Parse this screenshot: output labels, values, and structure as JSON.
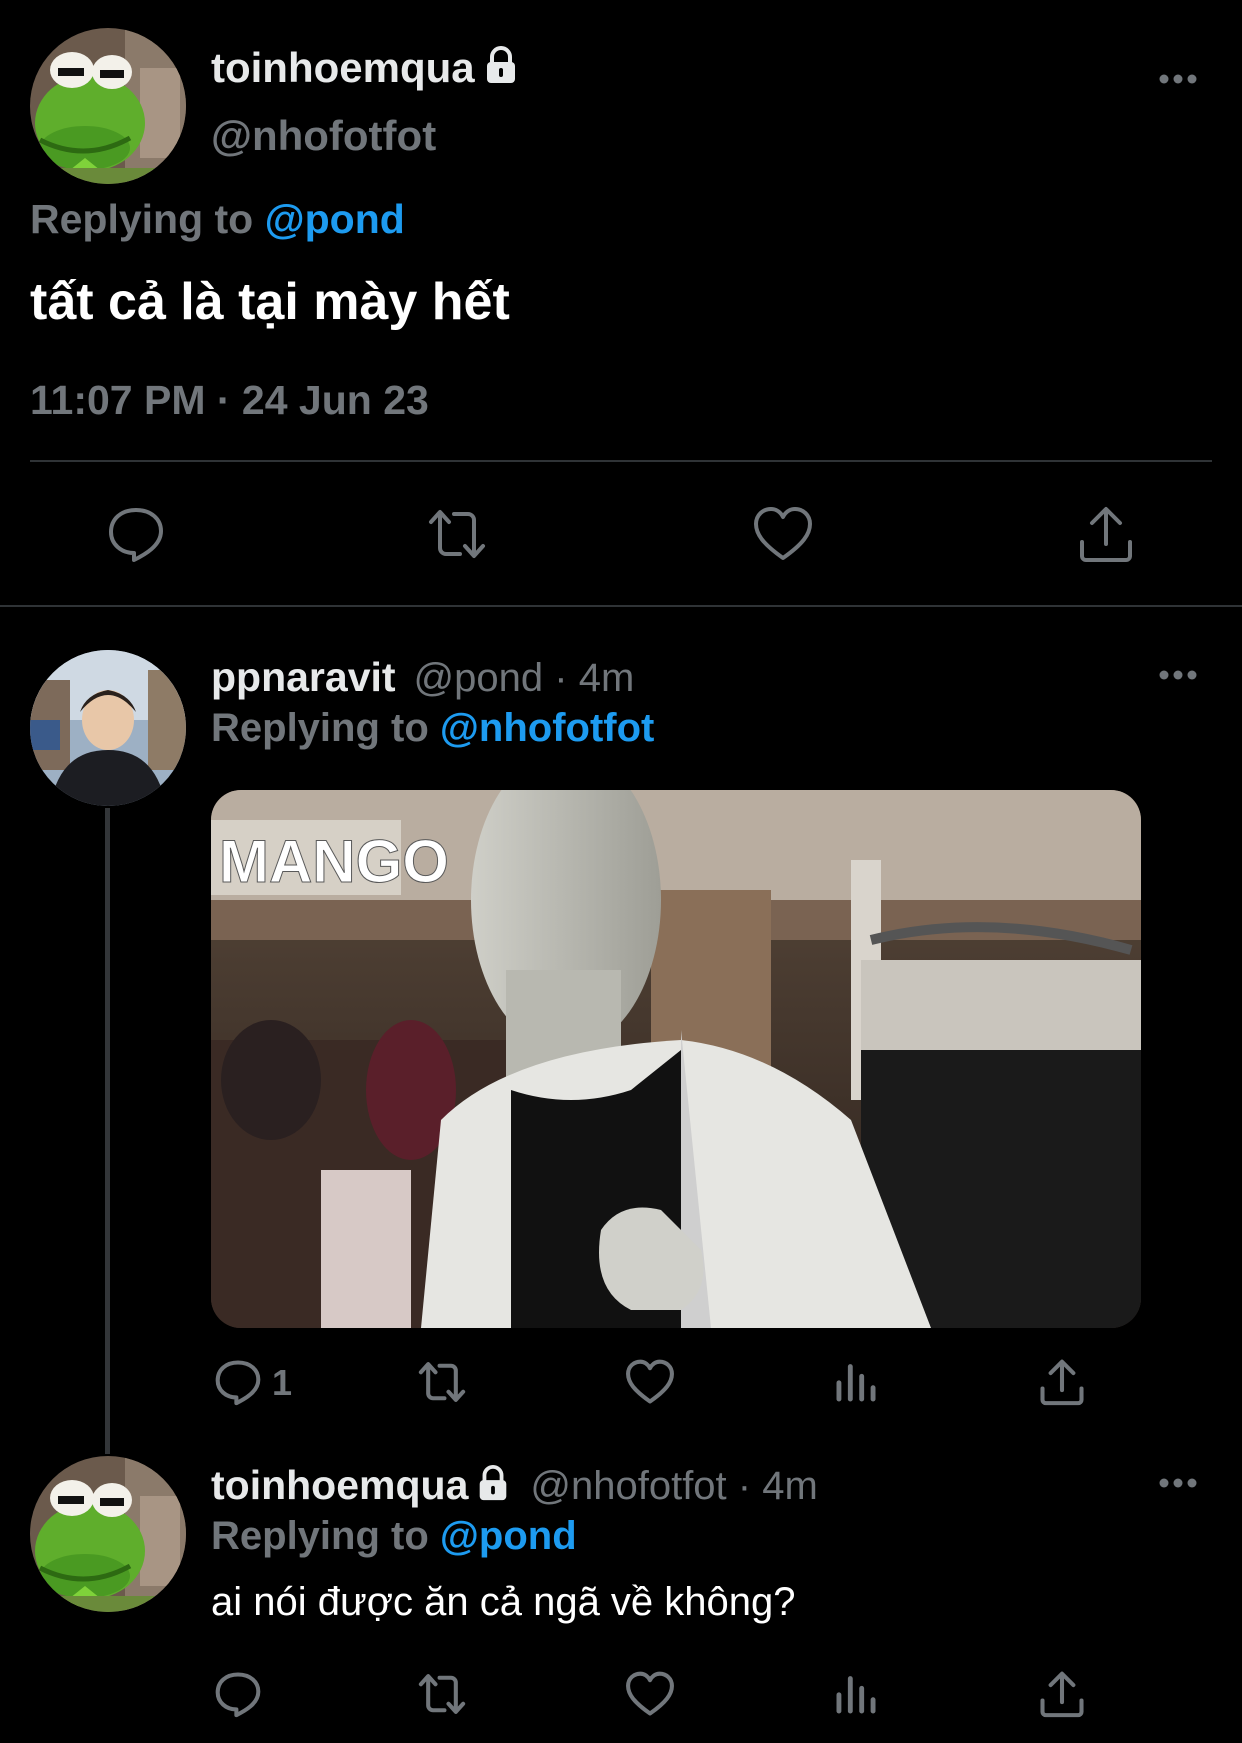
{
  "main_tweet": {
    "display_name": "toinhoemqua",
    "handle": "@nhofotfot",
    "replying_prefix": "Replying to",
    "replying_to": "@pond",
    "text": "tất cả là tại mày hết",
    "timestamp": "11:07 PM · 24 Jun 23",
    "protected": true,
    "avatar": "kermit-frog-avatar",
    "actions": [
      "reply-icon",
      "retweet-icon",
      "like-icon",
      "share-icon"
    ]
  },
  "reply_1": {
    "display_name": "ppnaravit",
    "handle": "@pond",
    "time": "· 4m",
    "replying_prefix": "Replying to",
    "replying_to": "@nhofotfot",
    "avatar": "person-photo-avatar",
    "media": "mannequin-photo",
    "media_text": "MANGO",
    "reply_count": "1",
    "actions": [
      "reply-icon",
      "retweet-icon",
      "like-icon",
      "views-icon",
      "share-icon"
    ]
  },
  "reply_2": {
    "display_name": "toinhoemqua",
    "handle": "@nhofotfot",
    "time": "· 4m",
    "replying_prefix": "Replying to",
    "replying_to": "@pond",
    "text": "ai nói được ăn cả ngã về không?",
    "protected": true,
    "avatar": "kermit-frog-avatar",
    "actions": [
      "reply-icon",
      "retweet-icon",
      "like-icon",
      "views-icon",
      "share-icon"
    ]
  },
  "colors": {
    "background": "#000000",
    "text_primary": "#e7e9ea",
    "text_secondary": "#71767b",
    "link": "#1d9bf0",
    "divider": "#2f3336"
  }
}
